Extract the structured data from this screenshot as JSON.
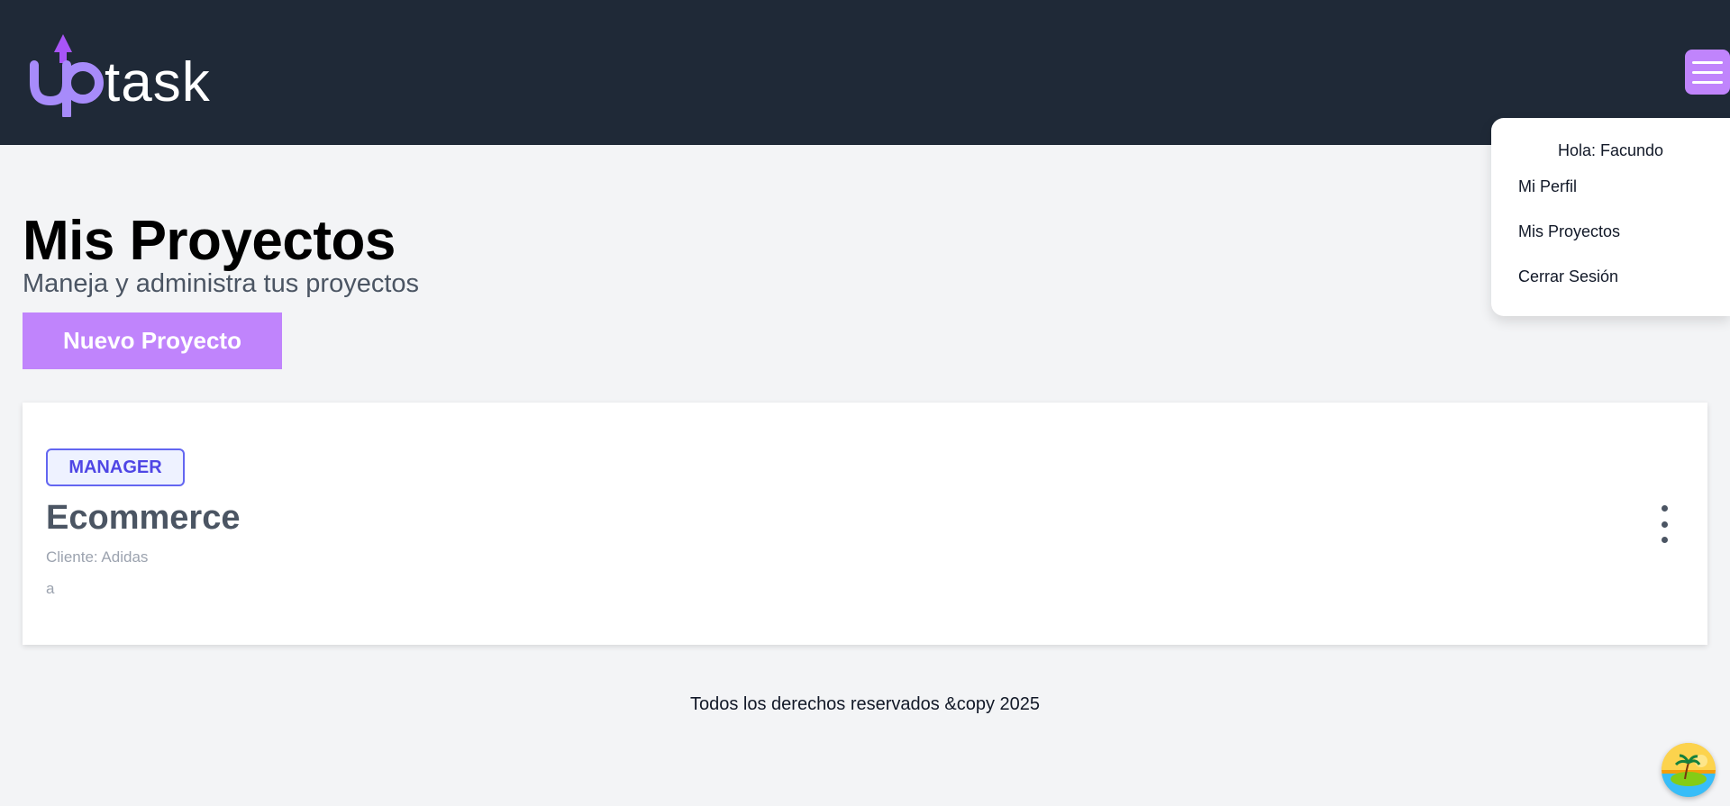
{
  "header": {
    "logo": {
      "prefix": "up",
      "suffix": "task",
      "accent_color": "#a78bfa",
      "arrow_color": "#a855f7"
    },
    "menu_icon": "hamburger-icon"
  },
  "user_menu": {
    "greeting": "Hola: Facundo",
    "items": [
      "Mi Perfil",
      "Mis Proyectos",
      "Cerrar Sesión"
    ]
  },
  "main": {
    "title": "Mis Proyectos",
    "subtitle": "Maneja y administra tus proyectos",
    "new_project_label": "Nuevo Proyecto"
  },
  "projects": [
    {
      "role": "MANAGER",
      "name": "Ecommerce",
      "client": "Cliente: Adidas",
      "description": "a",
      "options_icon": "vertical-dots-icon"
    }
  ],
  "footer": {
    "text": "Todos los derechos reservados &copy 2025"
  },
  "colors": {
    "header_bg": "#1f2937",
    "accent": "#c084fc",
    "badge_border": "#6366f1",
    "page_bg": "#f3f4f6"
  }
}
